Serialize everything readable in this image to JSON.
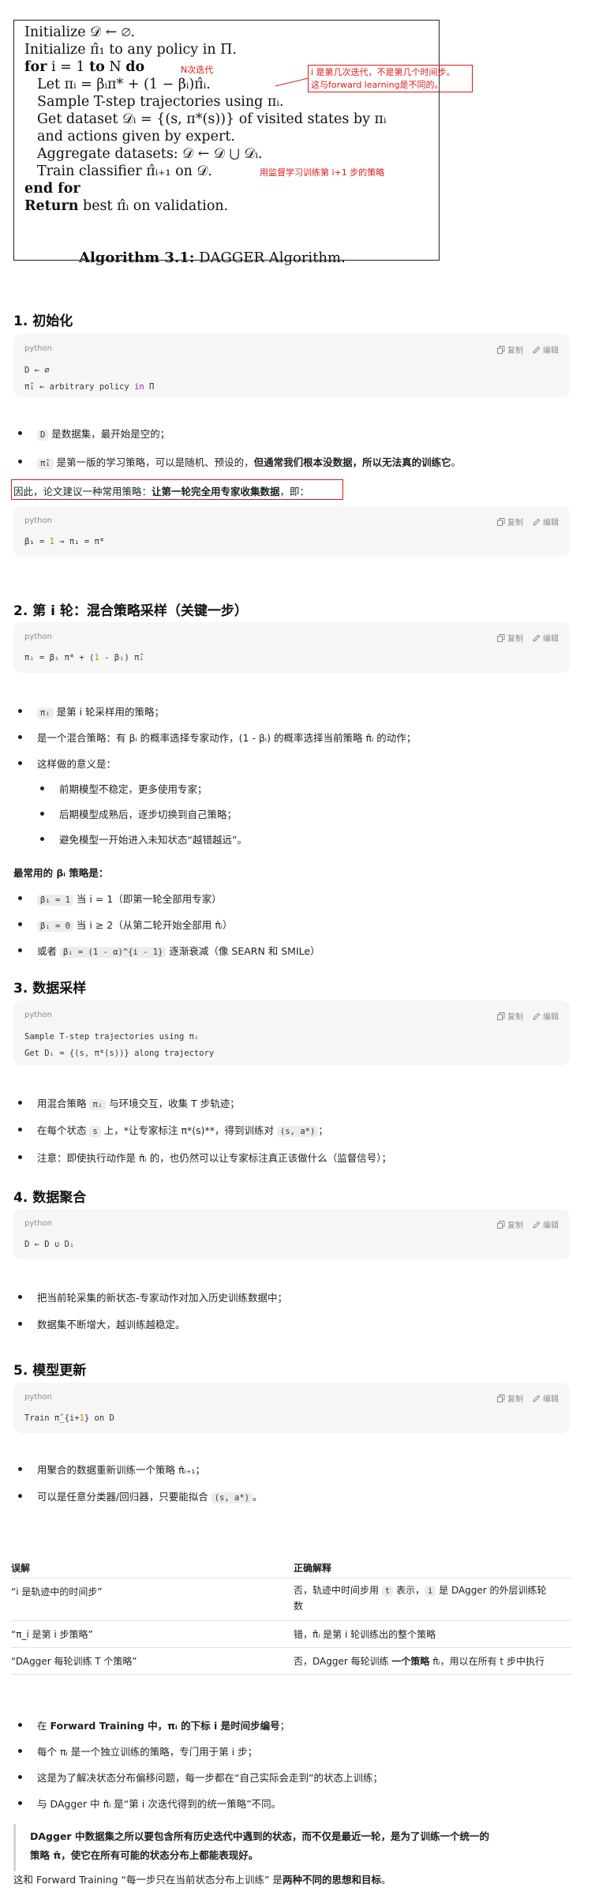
{
  "algorithm": {
    "lines": {
      "l1": "Initialize 𝒟 ← ∅.",
      "l2": "Initialize π̂₁ to any policy in Π.",
      "l3_kw": "for",
      "l3_mid": " i = 1 ",
      "l3_kw2": "to",
      "l3_mid2": " N ",
      "l3_kw3": "do",
      "l4": "Let πᵢ = βᵢπ* + (1 − βᵢ)π̂ᵢ.",
      "l5": "Sample T-step trajectories using πᵢ.",
      "l6": "Get dataset 𝒟ᵢ = {(s, π*(s))} of visited states by πᵢ",
      "l7": "and actions given by expert.",
      "l8": "Aggregate datasets: 𝒟 ← 𝒟 ⋃ 𝒟ᵢ.",
      "l9": "Train classifier π̂ᵢ₊₁ on 𝒟.",
      "l10": "end for",
      "l11_kw": "Return",
      "l11_rest": " best π̂ᵢ on validation."
    },
    "notes": {
      "n_iter": "N次迭代",
      "i_meaning_1": "i 是第几次迭代，不是第几个时间步。",
      "i_meaning_2": "这与forward learning是不同的。",
      "train_note": "用监督学习训练第 i+1 步的策略"
    },
    "caption_bold": "Algorithm 3.1:",
    "caption_rest": " DAGGER Algorithm."
  },
  "sections": {
    "s1_title": "1. 初始化",
    "s2_title": "2. 第 i 轮：混合策略采样（关键一步）",
    "s3_title": "3. 数据采样",
    "s4_title": "4. 数据聚合",
    "s5_title": "5. 模型更新"
  },
  "code": {
    "lang": "python",
    "copy": "复制",
    "edit": "编辑",
    "c1_l1": "D ← ∅",
    "c1_l2a": "π̂₁ ← arbitrary policy ",
    "c1_l2kw": "in",
    "c1_l2b": " Π",
    "c2_a": "β₁ = ",
    "c2_num": "1",
    "c2_b": " ⇒ π₁ = π*",
    "c3_a": "πᵢ = βᵢ π* + (",
    "c3_num": "1",
    "c3_b": " - βᵢ) π̂ᵢ",
    "c4_l1": "Sample T-step trajectories using πᵢ",
    "c4_l2": "Get Dᵢ = {(s, π*(s))} along trajectory",
    "c5_l1": "D ← D ∪ Dᵢ",
    "c6_a": "Train π̂_{i+",
    "c6_num": "1",
    "c6_b": "} on D"
  },
  "text": {
    "b1_code": "D",
    "b1_rest": " 是数据集，最开始是空的；",
    "b2_code": "π̂₁",
    "b2_rest": " 是第一版的学习策略，可以是随机、预设的，",
    "b2_bold": "但通常我们根本没数据，所以无法真的训练它",
    "b2_end": "。",
    "p1_a": "因此，论文建议一种常用策略：",
    "p1_bold": "让第一轮完全用专家收集数据",
    "p1_end": "，即：",
    "b3_code": "πᵢ",
    "b3_rest": " 是第 i 轮采样用的策略；",
    "b4": "是一个混合策略：有 βᵢ 的概率选择专家动作，(1 - βᵢ) 的概率选择当前策略 π̂ᵢ 的动作；",
    "b5": "这样做的意义是：",
    "b5a": "前期模型不稳定，更多使用专家；",
    "b5b": "后期模型成熟后，逐步切换到自己策略；",
    "b5c": "避免模型一开始进入未知状态“越错越远”。",
    "p2": "最常用的 βᵢ 策略是：",
    "b6_code": "β₁ = 1",
    "b6_rest": " 当 i = 1（即第一轮全部用专家）",
    "b7_code": "βᵢ = 0",
    "b7_rest": " 当 i ≥ 2（从第二轮开始全部用 π̂ᵢ）",
    "b8_a": "或者 ",
    "b8_code": "βᵢ = (1 - α)^{i - 1}",
    "b8_rest": " 逐渐衰减（像 SEARN 和 SMILe）",
    "b9_a": "用混合策略 ",
    "b9_code": "πᵢ",
    "b9_rest": " 与环境交互，收集 T 步轨迹；",
    "b10_a": "在每个状态 ",
    "b10_code1": "s",
    "b10_b": " 上，*让专家标注 π*(s)**，得到训练对 ",
    "b10_code2": "(s, a*)",
    "b10_end": "；",
    "b11": "注意：即使执行动作是 π̂ᵢ 的，也仍然可以让专家标注真正该做什么（监督信号）；",
    "b12": "把当前轮采集的新状态-专家动作对加入历史训练数据中；",
    "b13": "数据集不断增大，越训练越稳定。",
    "b14": "用聚合的数据重新训练一个策略 π̂ᵢ₊₁；",
    "b15_a": "可以是任意分类器/回归器，只要能拟合 ",
    "b15_code": "(s, a*)",
    "b15_end": "。"
  },
  "table": {
    "headers": [
      "误解",
      "正确解释"
    ],
    "rows": [
      {
        "wrong": "“i 是轨迹中的时间步”",
        "right_a": "否，轨迹中时间步用 ",
        "right_code1": "t",
        "right_b": " 表示，",
        "right_code2": "i",
        "right_c": " 是 DAgger 的外层训练轮",
        "right_line2": "数"
      },
      {
        "wrong": "“π_i 是第 i 步策略”",
        "right_a": "错，π̂ᵢ 是第 i 轮训练出的整个策略"
      },
      {
        "wrong": "“DAgger 每轮训练 T 个策略”",
        "right_a": "否，DAgger 每轮训练 ",
        "right_bold": "一个策略",
        "right_b": " π̂ᵢ，用以在所有 t 步中执行"
      }
    ]
  },
  "summary": {
    "s1_a": "在 ",
    "s1_bold1": "Forward Training 中，πᵢ 的下标 i 是时间步编号",
    "s1_end": "；",
    "s2": "每个 πᵢ 是一个独立训练的策略，专门用于第 i 步；",
    "s3": "这是为了解决状态分布偏移问题，每一步都在“自己实际会走到”的状态上训练；",
    "s4": "与 DAgger 中 π̂ᵢ 是“第 i 次迭代得到的统一策略”不同。",
    "quote_l1": "DAgger 中数据集之所以要包含所有历史迭代中遇到的状态，而不仅是最近一轮，是为了训练一个统一的",
    "quote_l2": "策略 π̂，使它在所有可能的状态分布上都能表现好。",
    "final_a": "这和 Forward Training “每一步只在当前状态分布上训练” 是",
    "final_bold": "两种不同的思想和目标",
    "final_end": "。"
  },
  "colors": {
    "accent_red": "#e01a1a",
    "code_bg": "#f6f6f7"
  }
}
